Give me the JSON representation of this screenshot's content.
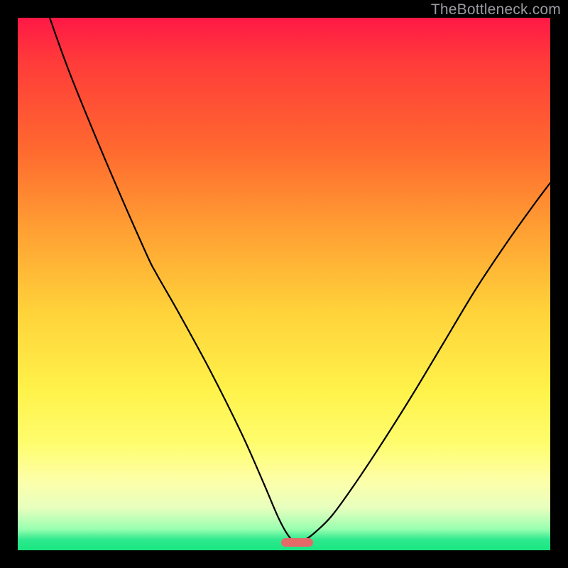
{
  "watermark": "TheBottleneck.com",
  "marker": {
    "color": "#e46a6a",
    "x_start_pct": 49.5,
    "x_end_pct": 55.5,
    "y_pct": 98.5
  },
  "chart_data": {
    "type": "line",
    "title": "",
    "xlabel": "",
    "ylabel": "",
    "x_range_pct": [
      0,
      100
    ],
    "y_range_pct": [
      0,
      100
    ],
    "gradient_stops": [
      {
        "pct": 0,
        "color": "#ff1846"
      },
      {
        "pct": 25,
        "color": "#ff6a2f"
      },
      {
        "pct": 55,
        "color": "#ffd23a"
      },
      {
        "pct": 80,
        "color": "#fffd6e"
      },
      {
        "pct": 96,
        "color": "#9affb0"
      },
      {
        "pct": 100,
        "color": "#18e681"
      }
    ],
    "curve_points_pct": [
      {
        "x": 6.0,
        "y": 0.0
      },
      {
        "x": 10.0,
        "y": 11.0
      },
      {
        "x": 17.0,
        "y": 28.0
      },
      {
        "x": 24.0,
        "y": 44.0
      },
      {
        "x": 26.0,
        "y": 48.0
      },
      {
        "x": 30.0,
        "y": 55.0
      },
      {
        "x": 36.0,
        "y": 66.0
      },
      {
        "x": 42.0,
        "y": 78.0
      },
      {
        "x": 46.0,
        "y": 87.0
      },
      {
        "x": 49.0,
        "y": 94.0
      },
      {
        "x": 51.0,
        "y": 97.5
      },
      {
        "x": 52.5,
        "y": 98.5
      },
      {
        "x": 54.0,
        "y": 98.0
      },
      {
        "x": 56.0,
        "y": 96.5
      },
      {
        "x": 59.0,
        "y": 93.5
      },
      {
        "x": 63.0,
        "y": 88.0
      },
      {
        "x": 68.0,
        "y": 80.5
      },
      {
        "x": 74.0,
        "y": 71.0
      },
      {
        "x": 80.0,
        "y": 61.0
      },
      {
        "x": 86.0,
        "y": 51.0
      },
      {
        "x": 92.0,
        "y": 42.0
      },
      {
        "x": 97.0,
        "y": 35.0
      },
      {
        "x": 100.0,
        "y": 31.0
      }
    ],
    "minimum_at_x_pct": 52.5,
    "annotation": "V-shaped bottleneck curve over vertical heat gradient"
  }
}
